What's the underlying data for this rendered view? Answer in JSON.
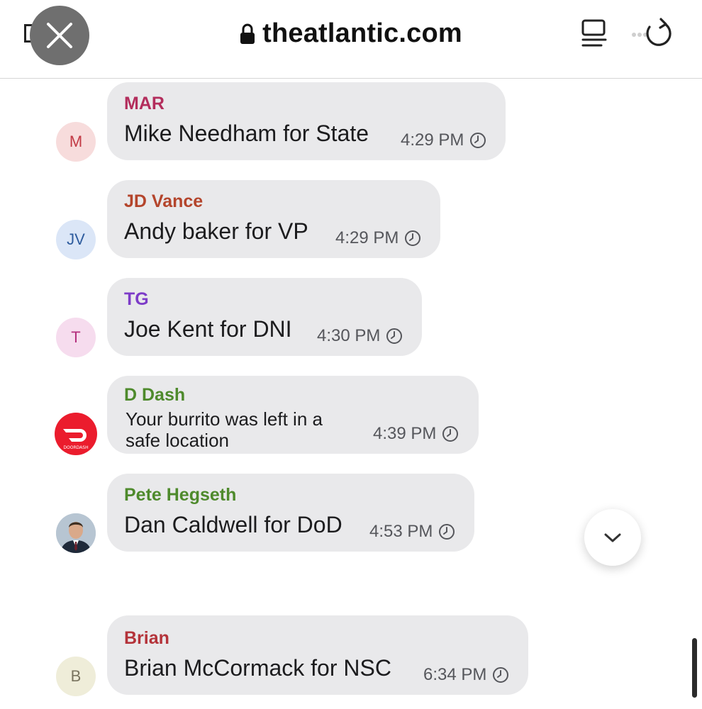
{
  "browser": {
    "url": "theatlantic.com",
    "icons": [
      "close-icon",
      "lock-icon",
      "reader-icon",
      "reload-icon"
    ]
  },
  "messages": [
    {
      "initials": "M",
      "avatar_bg": "#f7dcdc",
      "avatar_color": "#c23a45",
      "sender": "MAR",
      "sender_color": "#b32d5c",
      "text": "Mike Needham for State",
      "time": "4:29 PM"
    },
    {
      "initials": "JV",
      "avatar_bg": "#dbe6f7",
      "avatar_color": "#2e5c9e",
      "sender": "JD Vance",
      "sender_color": "#b4452c",
      "text": "Andy baker for VP",
      "time": "4:29 PM"
    },
    {
      "initials": "T",
      "avatar_bg": "#f6dcee",
      "avatar_color": "#b4307e",
      "sender": "TG",
      "sender_color": "#7d3cc8",
      "text": "Joe Kent for DNI",
      "time": "4:30 PM"
    },
    {
      "initials": "",
      "avatar_bg": "#eb1c2d",
      "avatar_label": "DOORDASH",
      "sender": "D Dash",
      "sender_color": "#4e8a2c",
      "text": "Your burrito was left in a safe location",
      "time": "4:39 PM"
    },
    {
      "initials": "",
      "avatar_bg": "#c9d3dc",
      "sender": "Pete Hegseth",
      "sender_color": "#4e8a2c",
      "text": "Dan Caldwell for DoD",
      "time": "4:53 PM"
    },
    {
      "initials": "B",
      "avatar_bg": "#efedd9",
      "avatar_color": "#7a7560",
      "sender": "Brian",
      "sender_color": "#b4333a",
      "text": "Brian McCormack for NSC",
      "time": "6:34 PM"
    }
  ],
  "controls": {
    "scroll_down_icon": "chevron-down-icon"
  }
}
